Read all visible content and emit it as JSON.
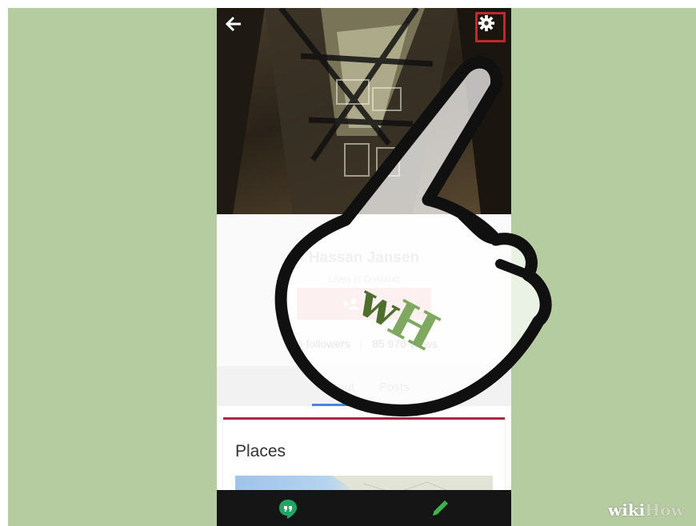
{
  "colors": {
    "background": "#b5cca0",
    "highlight": "#c0282e",
    "card_accent": "#a82b46",
    "tab_indicator": "#4a86e8",
    "bottom_bar": "#151515",
    "hangouts_green": "#21a464"
  },
  "header": {
    "back_icon": "arrow-left-icon",
    "settings_icon": "gear-icon"
  },
  "profile": {
    "name": "Hassan Jansen",
    "location": "Lives in Oakland",
    "add_button": {
      "icon": "add-person-icon",
      "label": "Add"
    },
    "followers": "16 followers",
    "views": "85 976 views"
  },
  "tabs": [
    {
      "label": "About",
      "selected": true
    },
    {
      "label": "Posts",
      "selected": false
    }
  ],
  "places_card": {
    "title": "Places"
  },
  "bottom_bar": {
    "left_icon": "hangouts-icon",
    "right_icon": "pencil-icon"
  },
  "overlay": {
    "logo_letters": "wH"
  },
  "watermark": {
    "part_a": "wiki",
    "part_b": "How"
  }
}
